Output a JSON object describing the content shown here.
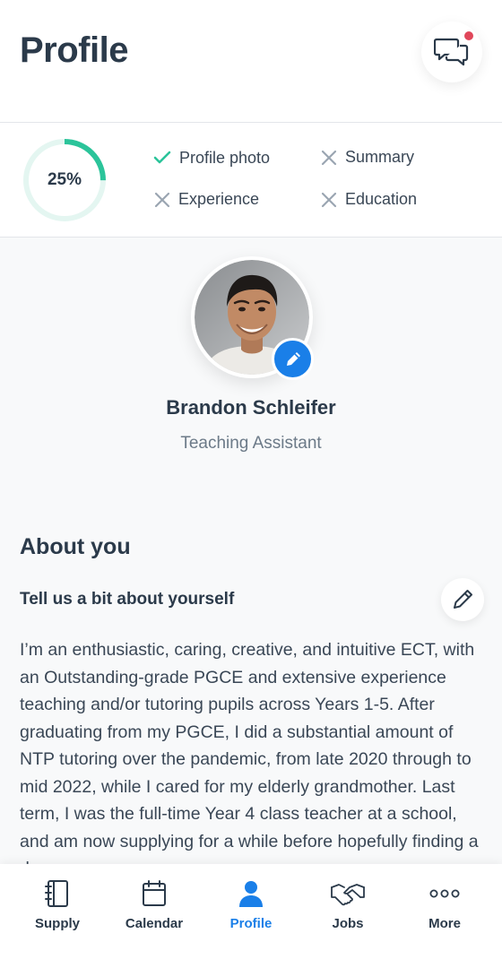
{
  "header": {
    "title": "Profile",
    "chat_icon": "chat-bubbles-icon",
    "notification_color": "#e0475a"
  },
  "completion": {
    "percent": 25,
    "percent_label": "25%",
    "items": [
      {
        "label": "Profile photo",
        "done": true
      },
      {
        "label": "Summary",
        "done": false
      },
      {
        "label": "Experience",
        "done": false
      },
      {
        "label": "Education",
        "done": false
      }
    ],
    "done_color": "#2bc49a",
    "todo_color": "#9aa5b1"
  },
  "profile": {
    "name": "Brandon Schleifer",
    "role": "Teaching Assistant",
    "edit_icon": "pencil-icon"
  },
  "about": {
    "title": "About you",
    "subtitle": "Tell us a bit about yourself",
    "text": "I’m an enthusiastic, caring, creative, and intuitive ECT, with an Outstanding-grade PGCE and extensive experience teaching and/or tutoring pupils across Years 1-5. After graduating from my PGCE, I did a substantial amount of NTP tutoring over the pandemic, from late 2020 through to mid 2022, while I cared for my elderly grandmother. Last term, I was the full-time Year 4 class teacher at a school, and am now supplying for a while before hopefully finding a dream"
  },
  "nav": {
    "active": "Profile",
    "accent": "#1a7fe8",
    "items": [
      {
        "label": "Supply",
        "icon": "notebook-icon"
      },
      {
        "label": "Calendar",
        "icon": "calendar-icon"
      },
      {
        "label": "Profile",
        "icon": "person-icon"
      },
      {
        "label": "Jobs",
        "icon": "handshake-icon"
      },
      {
        "label": "More",
        "icon": "more-dots-icon"
      }
    ]
  }
}
